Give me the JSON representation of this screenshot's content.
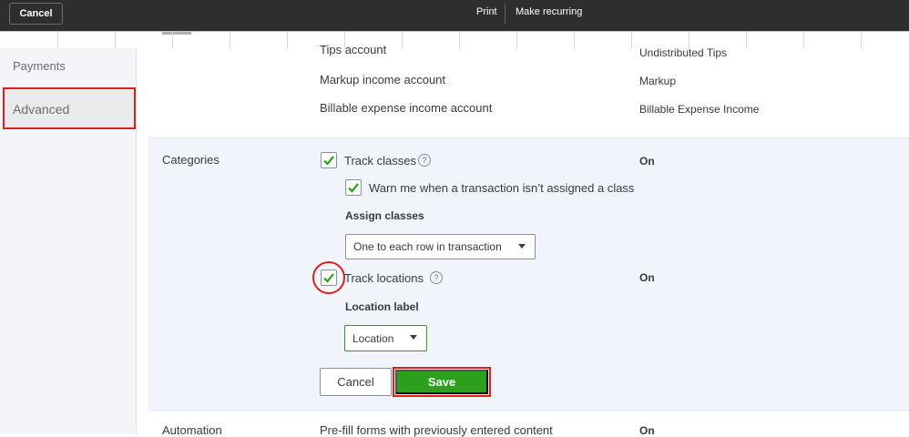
{
  "topbar": {
    "cancel_label": "Cancel",
    "print_label": "Print",
    "recurring_label": "Make recurring"
  },
  "sidebar": {
    "items": [
      {
        "label": "Payments"
      },
      {
        "label": "Advanced",
        "selected": true
      }
    ]
  },
  "accounts": {
    "rows": [
      {
        "label": "Tips account",
        "value": "Undistributed Tips"
      },
      {
        "label": "Markup income account",
        "value": "Markup"
      },
      {
        "label": "Billable expense income account",
        "value": "Billable Expense Income"
      }
    ]
  },
  "categories": {
    "title": "Categories",
    "track_classes": {
      "label": "Track classes",
      "checked": true,
      "status": "On"
    },
    "warn_class": {
      "label": "Warn me when a transaction isn’t assigned a class",
      "checked": true
    },
    "assign_classes_label": "Assign classes",
    "assign_classes_value": "One to each row in transaction",
    "track_locations": {
      "label": "Track locations",
      "checked": true,
      "status": "On"
    },
    "location_label_heading": "Location label",
    "location_label_value": "Location",
    "cancel_label": "Cancel",
    "save_label": "Save"
  },
  "automation": {
    "title": "Automation",
    "row_label": "Pre-fill forms with previously entered content",
    "status": "On"
  },
  "colors": {
    "accent_green": "#2ca01c",
    "highlight_red": "#e01e1e",
    "topbar": "#2d2e30"
  }
}
